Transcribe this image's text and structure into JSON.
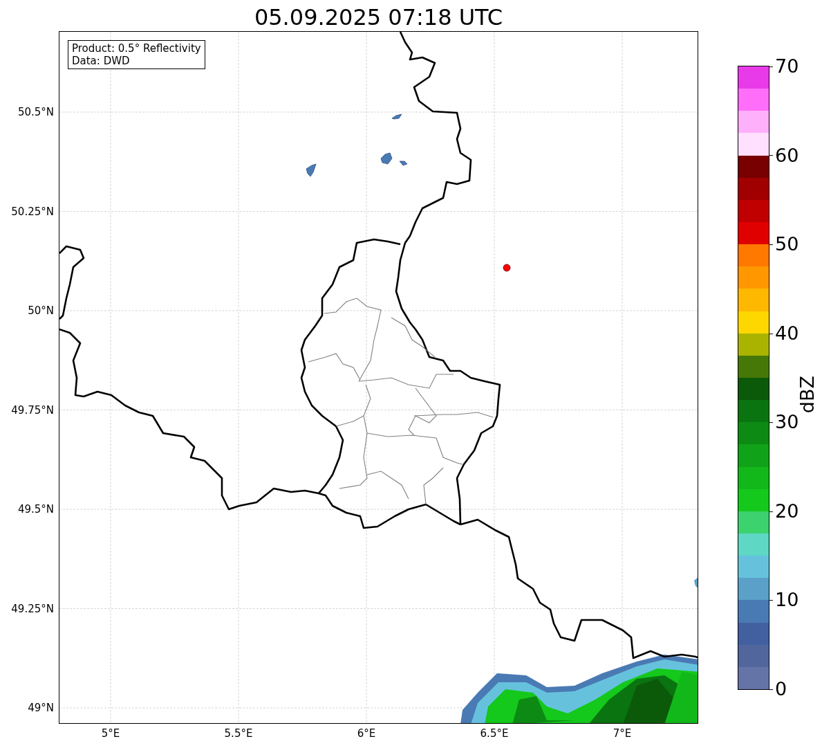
{
  "title": "05.09.2025 07:18 UTC",
  "info_box": [
    "Product: 0.5° Reflectivity",
    "Data: DWD"
  ],
  "map": {
    "lat_ticks": [
      "50.5°N",
      "50.25°N",
      "50°N",
      "49.75°N",
      "49.5°N",
      "49.25°N",
      "49°N"
    ],
    "lon_ticks": [
      "5°E",
      "5.5°E",
      "6°E",
      "6.5°E",
      "7°E"
    ]
  },
  "colorbar": {
    "label": "dBZ",
    "ticks": [
      "70",
      "60",
      "50",
      "40",
      "30",
      "20",
      "10",
      "0"
    ],
    "bins": [
      {
        "color": "#e93ae9"
      },
      {
        "color": "#ff6ef9"
      },
      {
        "color": "#ffb0fb"
      },
      {
        "color": "#ffe0ff"
      },
      {
        "color": "#780000"
      },
      {
        "color": "#a00000"
      },
      {
        "color": "#c00000"
      },
      {
        "color": "#e10000"
      },
      {
        "color": "#ff7800"
      },
      {
        "color": "#ff9800"
      },
      {
        "color": "#ffb800"
      },
      {
        "color": "#ffd700"
      },
      {
        "color": "#aab400"
      },
      {
        "color": "#467808"
      },
      {
        "color": "#0a5a0a"
      },
      {
        "color": "#0a7410"
      },
      {
        "color": "#0c8a14"
      },
      {
        "color": "#10a218"
      },
      {
        "color": "#12b81a"
      },
      {
        "color": "#14c81c"
      },
      {
        "color": "#3cd26e"
      },
      {
        "color": "#5ed7c4"
      },
      {
        "color": "#66c2dc"
      },
      {
        "color": "#5aa0c8"
      },
      {
        "color": "#4a7ab4"
      },
      {
        "color": "#4260a0"
      },
      {
        "color": "#52669e"
      },
      {
        "color": "#6474a6"
      }
    ]
  }
}
